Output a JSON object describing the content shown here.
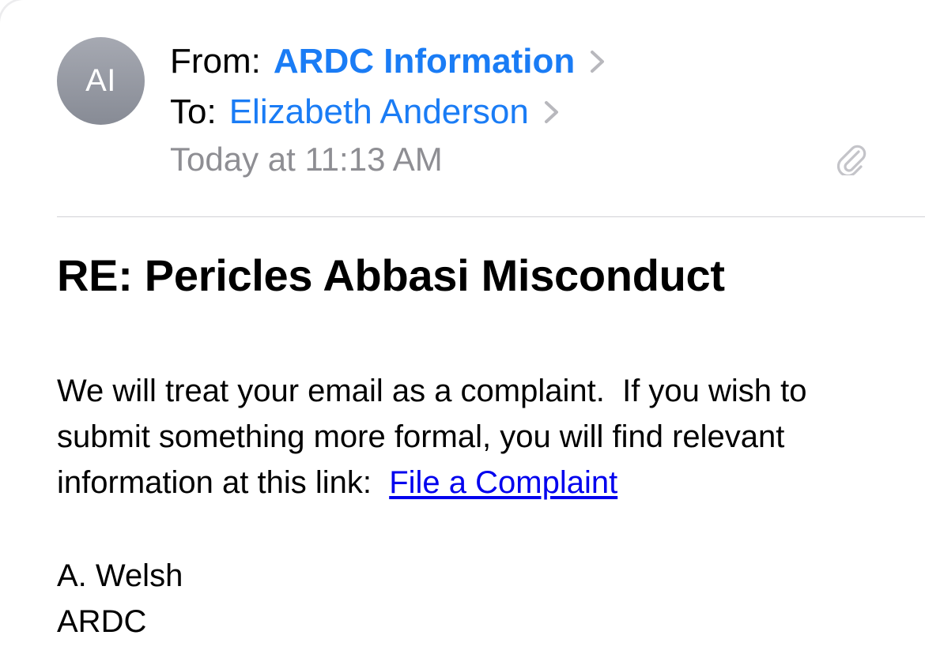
{
  "header": {
    "avatar_initials": "AI",
    "from_label": "From:",
    "from_name": "ARDC Information",
    "to_label": "To:",
    "to_name": "Elizabeth Anderson",
    "date": "Today at 11:13 AM"
  },
  "message": {
    "subject": "RE: Pericles Abbasi Misconduct",
    "body_text": "We will treat your email as a complaint.  If you wish to submit something more formal, you will find relevant information at this link:  ",
    "link_text": "File a Complaint",
    "signature": {
      "name": "A. Welsh",
      "org": "ARDC"
    }
  },
  "icons": {
    "from_chevron": "chevron-right-icon",
    "to_chevron": "chevron-right-icon",
    "attachment": "paperclip-icon"
  },
  "colors": {
    "accent": "#1a7cf5",
    "link": "#0000ee",
    "secondary_text": "#8e8e93",
    "avatar": "#8e9199"
  }
}
